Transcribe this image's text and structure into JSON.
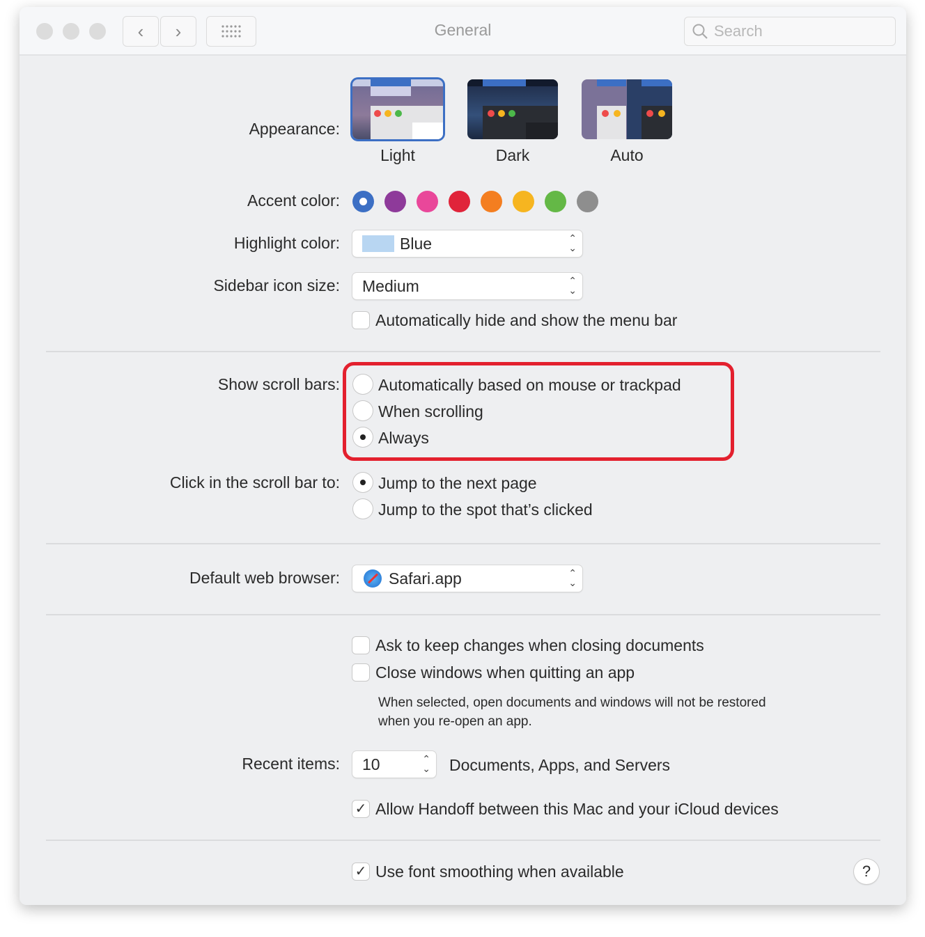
{
  "window": {
    "title": "General",
    "search_placeholder": "Search"
  },
  "appearance": {
    "label": "Appearance:",
    "options": [
      {
        "label": "Light",
        "selected": true
      },
      {
        "label": "Dark",
        "selected": false
      },
      {
        "label": "Auto",
        "selected": false
      }
    ]
  },
  "accent": {
    "label": "Accent color:",
    "colors": [
      "#3c6fc4",
      "#8e3a9a",
      "#e9479a",
      "#e0243a",
      "#f47e20",
      "#f6b520",
      "#64b846",
      "#8e8e8e"
    ],
    "selected": 0
  },
  "highlight": {
    "label": "Highlight color:",
    "value": "Blue",
    "swatch": "#b8d6f2"
  },
  "sidebar_icon": {
    "label": "Sidebar icon size:",
    "value": "Medium"
  },
  "menu_bar": {
    "label": "Automatically hide and show the menu bar",
    "checked": false
  },
  "scroll_bars": {
    "label": "Show scroll bars:",
    "options": [
      {
        "label": "Automatically based on mouse or trackpad",
        "selected": false
      },
      {
        "label": "When scrolling",
        "selected": false
      },
      {
        "label": "Always",
        "selected": true
      }
    ]
  },
  "click_scroll": {
    "label": "Click in the scroll bar to:",
    "options": [
      {
        "label": "Jump to the next page",
        "selected": true
      },
      {
        "label": "Jump to the spot that’s clicked",
        "selected": false
      }
    ]
  },
  "browser": {
    "label": "Default web browser:",
    "value": "Safari.app"
  },
  "ask_keep": {
    "label": "Ask to keep changes when closing documents",
    "checked": false
  },
  "close_windows": {
    "label": "Close windows when quitting an app",
    "checked": false,
    "note_line1": "When selected, open documents and windows will not be restored",
    "note_line2": "when you re-open an app."
  },
  "recent": {
    "label": "Recent items:",
    "value": "10",
    "suffix": "Documents, Apps, and Servers"
  },
  "handoff": {
    "label": "Allow Handoff between this Mac and your iCloud devices",
    "checked": true
  },
  "font_smoothing": {
    "label": "Use font smoothing when available",
    "checked": true
  },
  "help": "?"
}
